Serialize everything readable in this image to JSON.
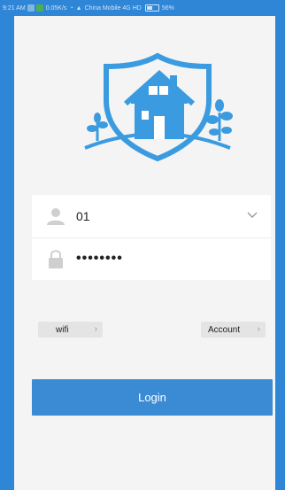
{
  "status_bar": {
    "time": "9:21 AM",
    "network_speed": "0.05K/s",
    "carrier": "China Mobile 4G HD",
    "battery": "56%"
  },
  "login_form": {
    "username_value": "01",
    "password_value": "••••••••"
  },
  "links": {
    "wifi_label": "wifi",
    "account_label": "Account"
  },
  "login_button_label": "Login",
  "colors": {
    "accent": "#2f86d6",
    "button": "#3a8bd4"
  }
}
